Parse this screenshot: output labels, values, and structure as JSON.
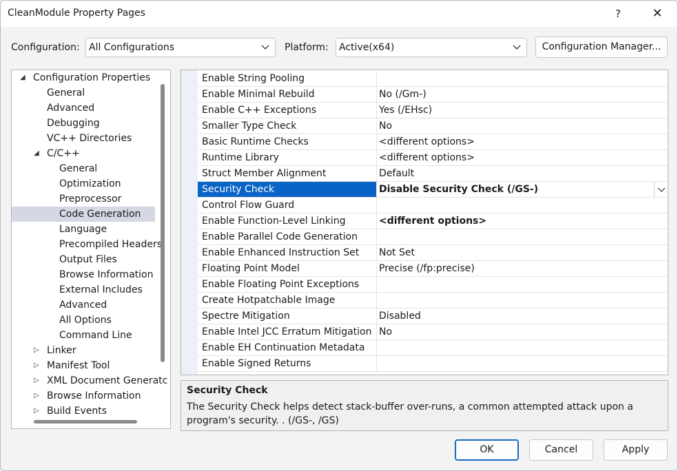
{
  "window": {
    "title": "CleanModule Property Pages",
    "help_glyph": "?",
    "close_glyph": "✕"
  },
  "config_bar": {
    "configuration_label": "Configuration:",
    "configuration_value": "All Configurations",
    "platform_label": "Platform:",
    "platform_value": "Active(x64)",
    "config_manager_label": "Configuration Manager..."
  },
  "tree": {
    "items": [
      {
        "label": "Configuration Properties",
        "expander": "◢"
      },
      {
        "label": "General"
      },
      {
        "label": "Advanced"
      },
      {
        "label": "Debugging"
      },
      {
        "label": "VC++ Directories"
      },
      {
        "label": "C/C++",
        "expander": "◢"
      },
      {
        "label": "General"
      },
      {
        "label": "Optimization"
      },
      {
        "label": "Preprocessor"
      },
      {
        "label": "Code Generation"
      },
      {
        "label": "Language"
      },
      {
        "label": "Precompiled Headers"
      },
      {
        "label": "Output Files"
      },
      {
        "label": "Browse Information"
      },
      {
        "label": "External Includes"
      },
      {
        "label": "Advanced"
      },
      {
        "label": "All Options"
      },
      {
        "label": "Command Line"
      },
      {
        "label": "Linker",
        "expander": "▷"
      },
      {
        "label": "Manifest Tool",
        "expander": "▷"
      },
      {
        "label": "XML Document Generatc",
        "expander": "▷"
      },
      {
        "label": "Browse Information",
        "expander": "▷"
      },
      {
        "label": "Build Events",
        "expander": "▷"
      }
    ]
  },
  "properties": [
    {
      "name": "Enable String Pooling",
      "value": ""
    },
    {
      "name": "Enable Minimal Rebuild",
      "value": "No (/Gm-)"
    },
    {
      "name": "Enable C++ Exceptions",
      "value": "Yes (/EHsc)"
    },
    {
      "name": "Smaller Type Check",
      "value": "No"
    },
    {
      "name": "Basic Runtime Checks",
      "value": "<different options>"
    },
    {
      "name": "Runtime Library",
      "value": "<different options>"
    },
    {
      "name": "Struct Member Alignment",
      "value": "Default"
    },
    {
      "name": "Security Check",
      "value": "Disable Security Check (/GS-)"
    },
    {
      "name": "Control Flow Guard",
      "value": ""
    },
    {
      "name": "Enable Function-Level Linking",
      "value": "<different options>"
    },
    {
      "name": "Enable Parallel Code Generation",
      "value": ""
    },
    {
      "name": "Enable Enhanced Instruction Set",
      "value": "Not Set"
    },
    {
      "name": "Floating Point Model",
      "value": "Precise (/fp:precise)"
    },
    {
      "name": "Enable Floating Point Exceptions",
      "value": ""
    },
    {
      "name": "Create Hotpatchable Image",
      "value": ""
    },
    {
      "name": "Spectre Mitigation",
      "value": "Disabled"
    },
    {
      "name": "Enable Intel JCC Erratum Mitigation",
      "value": "No"
    },
    {
      "name": "Enable EH Continuation Metadata",
      "value": ""
    },
    {
      "name": "Enable Signed Returns",
      "value": ""
    }
  ],
  "description": {
    "title": "Security Check",
    "text": "The Security Check helps detect stack-buffer over-runs, a common attempted attack upon a program's security.  .  (/GS-, /GS)"
  },
  "buttons": {
    "ok": "OK",
    "cancel": "Cancel",
    "apply": "Apply"
  },
  "colors": {
    "selection": "#0a64c8",
    "tree_selection": "#d5d8e3"
  }
}
